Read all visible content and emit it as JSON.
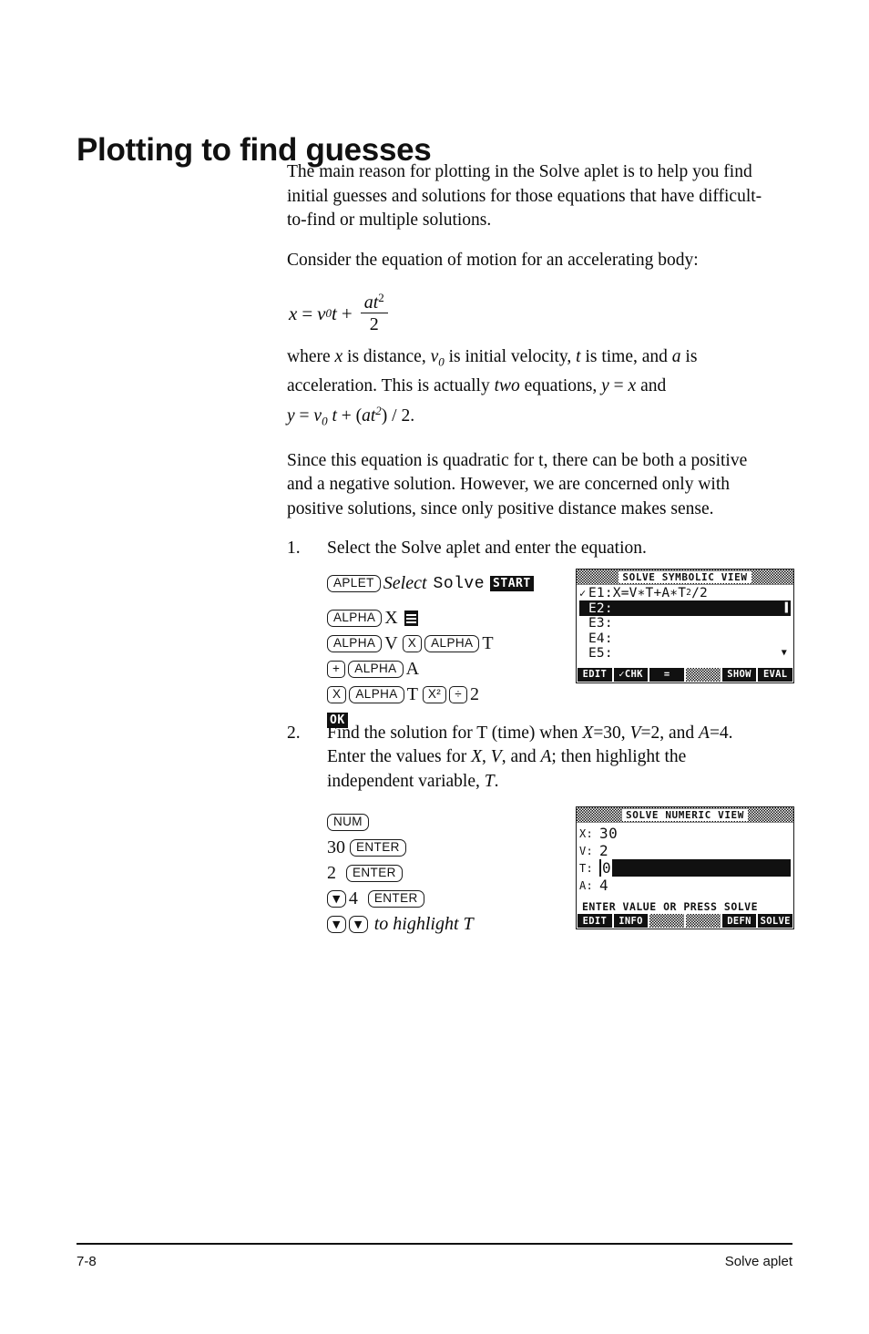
{
  "document": {
    "title": "Plotting to find guesses",
    "footer": {
      "page_number": "7-8",
      "chapter_label": "Solve aplet"
    }
  },
  "paragraphs": {
    "p1": "The main reason for plotting in the Solve aplet is to help you find initial guesses and solutions for those equations that have difficult-to-find or multiple solutions.",
    "p2": "Consider the equation of motion for an accelerating body:",
    "p3_pre": "where ",
    "p3": "where x is distance, v0 is initial velocity, t is time, and a is acceleration. This is actually two equations, y = x and y = v0 t + (at2) / 2.",
    "p4": "Since this equation is quadratic for t, there can be both a positive and a negative solution. However, we are concerned only with positive solutions, since only positive distance makes sense."
  },
  "equation": {
    "lhs": "x",
    "eq_sign": "=",
    "term1_var": "v",
    "term1_sub": "0",
    "term1_t": "t",
    "plus": "+",
    "numerator_a": "a",
    "numerator_t": "t",
    "numerator_exp": "2",
    "denominator": "2"
  },
  "prose_fragments": {
    "where_1": "where ",
    "where_x": "x",
    "where_2": " is distance, ",
    "where_v": "v",
    "where_v_sub": "0",
    "where_3": " is initial velocity, ",
    "where_t": "t",
    "where_4": " is time, and ",
    "where_a": "a",
    "where_5": " is",
    "accel_1": "acceleration. This is actually ",
    "accel_two": "two",
    "accel_2": " equations, ",
    "accel_y": "y",
    "accel_3": " = ",
    "accel_x": "x",
    "accel_4": " and",
    "line3_y": "y",
    "line3_eq": " = ",
    "line3_v": "v",
    "line3_vsub": "0",
    "line3_t": " t",
    "line3_plus": " + (",
    "line3_at": "at",
    "line3_sup": "2",
    "line3_end": ") / 2."
  },
  "steps": [
    {
      "number": "1.",
      "text": "Select the Solve aplet and enter the equation."
    },
    {
      "number": "2.",
      "text_parts": {
        "a": "Find the solution for T (time) when ",
        "x_var": "X",
        "b": "=30, ",
        "v_var": "V",
        "c": "=2, and",
        "d": "A",
        "e": "=4. Enter the values for ",
        "f": "X",
        "g": ", ",
        "h": "V",
        "i": ", and ",
        "j": "A",
        "k": "; then highlight the",
        "l": "independent variable, ",
        "m": "T",
        "n": "."
      }
    }
  ],
  "keystrokes_step1": {
    "line1": {
      "key_aplet": "APLET",
      "word_select": "Select",
      "word_solve": "Solve",
      "softkey_start": "START"
    },
    "line2": {
      "key_alpha": "ALPHA",
      "letter_x": "X",
      "equals_glyph": "=-key"
    },
    "line3": {
      "key_alpha_1": "ALPHA",
      "letter_v": "V",
      "key_times": "X",
      "key_alpha_2": "ALPHA",
      "letter_t": "T"
    },
    "line4": {
      "key_plus": "+",
      "key_alpha": "ALPHA",
      "letter_a": "A"
    },
    "line5": {
      "key_times": "X",
      "key_alpha": "ALPHA",
      "letter_t": "T",
      "key_square": "X²",
      "key_divide": "÷",
      "digit_2": "2"
    },
    "line6": {
      "softkey_ok": "OK"
    }
  },
  "keystrokes_step2": {
    "line1": {
      "key_num": "NUM"
    },
    "line2": {
      "value": "30",
      "key_enter": "ENTER"
    },
    "line3": {
      "value": "2",
      "key_enter": "ENTER"
    },
    "line4": {
      "key_down": "▼",
      "value": "4",
      "key_enter": "ENTER"
    },
    "line5": {
      "key_down_1": "▼",
      "key_down_2": "▼",
      "caption": "to highlight T"
    }
  },
  "lcd_symbolic": {
    "title": "SOLVE SYMBOLIC VIEW",
    "rows": [
      {
        "check": "✓",
        "label": "E1:",
        "value": "X=V∗T+A∗T",
        "exp": "2",
        "value_tail": "/2",
        "highlighted": false
      },
      {
        "check": "",
        "label": "E2:",
        "value": "",
        "highlighted": true,
        "tail": "▐"
      },
      {
        "check": "",
        "label": "E3:",
        "value": "",
        "highlighted": false
      },
      {
        "check": "",
        "label": "E4:",
        "value": "",
        "highlighted": false
      },
      {
        "check": "",
        "label": "E5:",
        "value": "",
        "highlighted": false,
        "scroll": "▼"
      }
    ],
    "softkeys": [
      "EDIT",
      "✓CHK",
      "=",
      "",
      "SHOW",
      "EVAL"
    ]
  },
  "lcd_numeric": {
    "title": "SOLVE NUMERIC VIEW",
    "rows": [
      {
        "label": "X:",
        "value": "30",
        "highlighted": false
      },
      {
        "label": "V:",
        "value": "2",
        "highlighted": false
      },
      {
        "label": "T:",
        "value": "0",
        "highlighted": true
      },
      {
        "label": "A:",
        "value": "4",
        "highlighted": false
      }
    ],
    "status": "ENTER VALUE OR PRESS SOLVE",
    "softkeys": [
      "EDIT",
      "INFO",
      "",
      "",
      "DEFN",
      "SOLVE"
    ]
  },
  "colors": {
    "ink": "#111111",
    "paper": "#ffffff"
  }
}
